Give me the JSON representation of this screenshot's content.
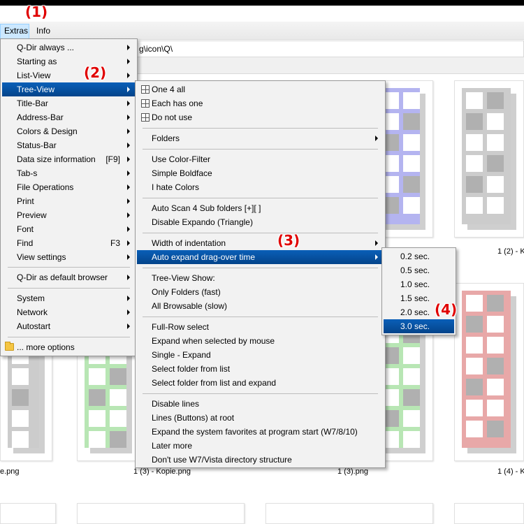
{
  "menubar": {
    "items": [
      "Extras",
      "Info"
    ]
  },
  "address": {
    "path_fragment": "g\\icon\\Q\\"
  },
  "annotations": [
    "(1)",
    "(2)",
    "(3)",
    "(4)"
  ],
  "thumbnails": {
    "captions": [
      "1 (2) - K",
      "e.png",
      "1 (3) - Kopie.png",
      "1 (3).png",
      "1 (4) - K"
    ]
  },
  "colors": {
    "selection": "#0a4f9e",
    "annotation": "#e00000",
    "thumb_blue": "#b4b4f0",
    "thumb_gray": "#cccccc",
    "thumb_green": "#b8e6b4",
    "thumb_red": "#e8a8a8",
    "thumb_yellow": "#e8e0b0"
  },
  "extras_menu": {
    "items": [
      {
        "label": "Q-Dir always ...",
        "submenu": true
      },
      {
        "label": "Starting as",
        "submenu": true
      },
      {
        "label": "List-View",
        "submenu": true
      },
      {
        "label": "Tree-View",
        "submenu": true,
        "selected": true
      },
      {
        "label": "Title-Bar",
        "submenu": true
      },
      {
        "label": "Address-Bar",
        "submenu": true
      },
      {
        "label": "Colors & Design",
        "submenu": true
      },
      {
        "label": "Status-Bar",
        "submenu": true
      },
      {
        "label": "Data size information",
        "shortcut": "[F9]",
        "submenu": true
      },
      {
        "label": "Tab-s",
        "submenu": true
      },
      {
        "label": "File Operations",
        "submenu": true
      },
      {
        "label": "Print",
        "submenu": true
      },
      {
        "label": "Preview",
        "submenu": true
      },
      {
        "label": "Font",
        "submenu": true
      },
      {
        "label": "Find",
        "shortcut": "F3",
        "submenu": true
      },
      {
        "label": "View settings",
        "submenu": true
      },
      {
        "label": "Q-Dir as default browser",
        "submenu": true
      },
      {
        "label": "System",
        "submenu": true
      },
      {
        "label": "Network",
        "submenu": true
      },
      {
        "label": "Autostart",
        "submenu": true
      },
      {
        "label": "... more options",
        "icon": "folder-icon"
      }
    ]
  },
  "treeview_menu": {
    "items": [
      {
        "label": "One 4 all",
        "icon": "grid-icon"
      },
      {
        "label": "Each has one",
        "icon": "grid-icon"
      },
      {
        "label": "Do not use",
        "icon": "grid-icon"
      },
      {
        "label": "Folders",
        "submenu": true
      },
      {
        "label": "Use Color-Filter"
      },
      {
        "label": "Simple Boldface"
      },
      {
        "label": "I hate Colors"
      },
      {
        "label": "Auto Scan 4 Sub folders  [+][ ]"
      },
      {
        "label": "Disable Expando (Triangle)"
      },
      {
        "label": "Width of indentation",
        "submenu": true
      },
      {
        "label": "Auto expand drag-over time",
        "submenu": true,
        "selected": true
      },
      {
        "label": "Tree-View Show:"
      },
      {
        "label": "Only Folders (fast)"
      },
      {
        "label": "All Browsable (slow)"
      },
      {
        "label": "Full-Row select"
      },
      {
        "label": "Expand when selected by mouse"
      },
      {
        "label": "Single - Expand"
      },
      {
        "label": "Select folder from list"
      },
      {
        "label": "Select folder from list and expand"
      },
      {
        "label": "Disable lines"
      },
      {
        "label": "Lines (Buttons) at root"
      },
      {
        "label": "Expand the system favorites at program start (W7/8/10)"
      },
      {
        "label": "Later more"
      },
      {
        "label": "Don't use W7/Vista directory structure"
      }
    ]
  },
  "dragover_menu": {
    "items": [
      {
        "label": "0.2 sec."
      },
      {
        "label": "0.5 sec."
      },
      {
        "label": "1.0 sec."
      },
      {
        "label": "1.5 sec."
      },
      {
        "label": "2.0 sec."
      },
      {
        "label": "3.0 sec.",
        "selected": true
      }
    ]
  }
}
